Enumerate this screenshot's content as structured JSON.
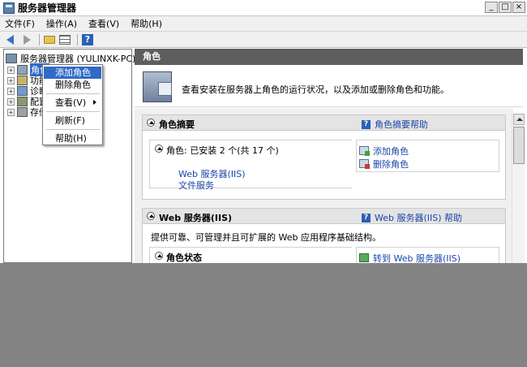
{
  "window": {
    "title": "服务器管理器",
    "buttons": [
      "_",
      "□",
      "×"
    ]
  },
  "menubar": [
    "文件(F)",
    "操作(A)",
    "查看(V)",
    "帮助(H)"
  ],
  "toolbar": [
    "back-icon",
    "forward-icon",
    "up-folder-icon",
    "show-hide-tree-icon",
    "help-icon"
  ],
  "tree": {
    "root": "服务器管理器 (YULINXK-PC)",
    "nodes": [
      {
        "label": "角色",
        "selected": true
      },
      {
        "label": "功能"
      },
      {
        "label": "诊断"
      },
      {
        "label": "配置"
      },
      {
        "label": "存储"
      }
    ]
  },
  "context_menu": {
    "items": [
      "添加角色",
      "删除角色",
      "查看(V)",
      "刷新(F)",
      "帮助(H)"
    ],
    "highlighted": "添加角色"
  },
  "main": {
    "section_title": "角色",
    "intro": "查看安装在服务器上角色的运行状况，以及添加或删除角色和功能。",
    "roles_summary": {
      "title": "角色摘要",
      "help": "角色摘要帮助",
      "roles_line": "角色: 已安装 2 个(共 17 个)",
      "installed": [
        "Web 服务器(IIS)",
        "文件服务"
      ],
      "actions": [
        "添加角色",
        "删除角色"
      ]
    },
    "web_server": {
      "title": "Web 服务器(IIS)",
      "help": "Web 服务器(IIS) 帮助",
      "description": "提供可靠、可管理并且可扩展的 Web 应用程序基础结构。",
      "status_title": "角色状态",
      "action": "转到 Web 服务器(IIS)"
    }
  },
  "colors": {
    "selection": "#3169c6",
    "link": "#1a45a8",
    "section_header": "#5e5e5e",
    "overlay": "#838383"
  }
}
